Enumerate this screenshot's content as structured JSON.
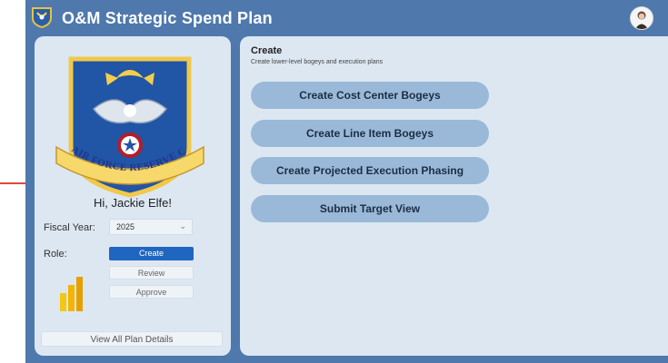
{
  "header": {
    "title": "O&M Strategic Spend Plan",
    "app_icon": "command-shield-icon",
    "user_avatar": "user-avatar-icon"
  },
  "sidebar": {
    "emblem": {
      "icon": "air-force-reserve-command-emblem",
      "text": "AIR FORCE RESERVE COMMAND"
    },
    "greeting": "Hi, Jackie Elfe!",
    "fiscal_year": {
      "label": "Fiscal Year:",
      "value": "2025"
    },
    "role": {
      "label": "Role:",
      "options": [
        {
          "label": "Create",
          "active": true
        },
        {
          "label": "Review",
          "active": false
        },
        {
          "label": "Approve",
          "active": false
        }
      ]
    },
    "powerbi_icon": "power-bi-icon",
    "view_all_label": "View All Plan Details"
  },
  "main": {
    "title": "Create",
    "subtitle": "Create lower-level bogeys and execution plans",
    "actions": [
      "Create Cost Center Bogeys",
      "Create Line Item Bogeys",
      "Create Projected Execution Phasing",
      "Submit Target View"
    ]
  },
  "colors": {
    "header_bg": "#4f78ad",
    "panel_bg": "#dce7f2",
    "action_button_bg": "#9ab9d8",
    "active_role_bg": "#1f66c1",
    "accent_line": "#e0483b"
  }
}
